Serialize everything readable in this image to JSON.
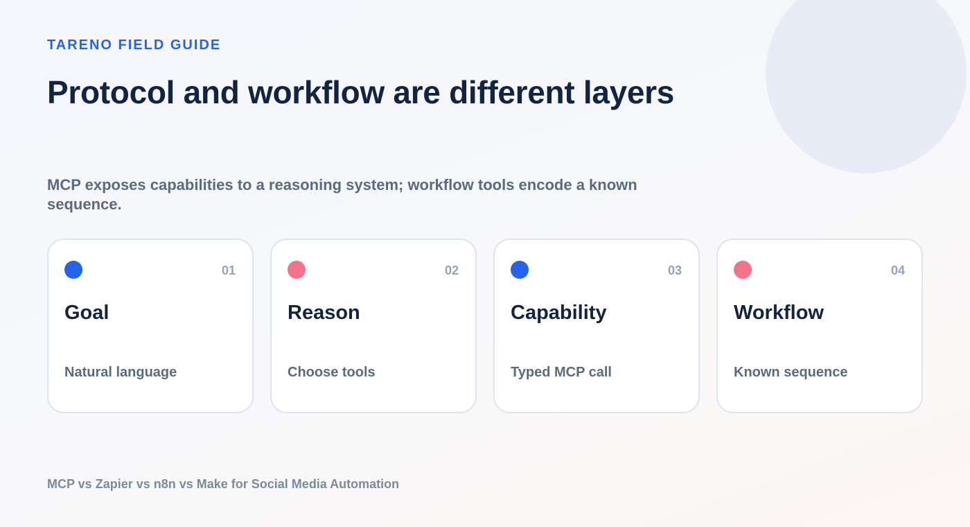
{
  "eyebrow": "TARENO FIELD GUIDE",
  "title": "Protocol and workflow are different layers",
  "subtitle": "MCP exposes capabilities to a reasoning system; workflow tools encode a known sequence.",
  "cards": [
    {
      "number": "01",
      "title": "Goal",
      "description": "Natural language",
      "dot_color": "#2563eb"
    },
    {
      "number": "02",
      "title": "Reason",
      "description": "Choose tools",
      "dot_color": "#f4728a"
    },
    {
      "number": "03",
      "title": "Capability",
      "description": "Typed MCP call",
      "dot_color": "#2563eb"
    },
    {
      "number": "04",
      "title": "Workflow",
      "description": "Known sequence",
      "dot_color": "#f4728a"
    }
  ],
  "footer": "MCP vs Zapier vs n8n vs Make for Social Media Automation",
  "colors": {
    "accent": "#2563eb",
    "accent_secondary": "#f4728a",
    "heading": "#132440",
    "body_text": "#5a6b80"
  }
}
